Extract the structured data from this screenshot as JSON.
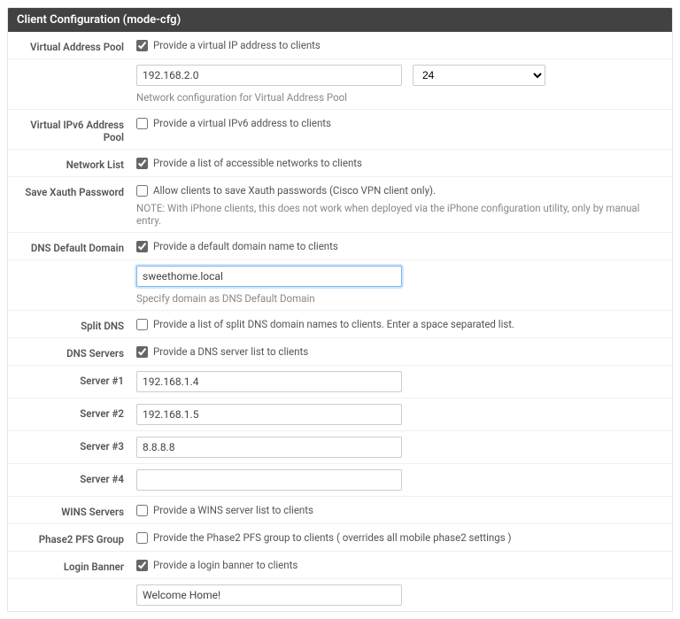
{
  "panel": {
    "title": "Client Configuration (mode-cfg)"
  },
  "virtual_address_pool": {
    "label": "Virtual Address Pool",
    "checked": true,
    "desc": "Provide a virtual IP address to clients",
    "ip_value": "192.168.2.0",
    "prefix_value": "24",
    "help": "Network configuration for Virtual Address Pool"
  },
  "virtual_ipv6_pool": {
    "label": "Virtual IPv6 Address Pool",
    "checked": false,
    "desc": "Provide a virtual IPv6 address to clients"
  },
  "network_list": {
    "label": "Network List",
    "checked": true,
    "desc": "Provide a list of accessible networks to clients"
  },
  "save_xauth": {
    "label": "Save Xauth Password",
    "checked": false,
    "desc": "Allow clients to save Xauth passwords (Cisco VPN client only).",
    "note": "NOTE: With iPhone clients, this does not work when deployed via the iPhone configuration utility, only by manual entry."
  },
  "dns_default_domain": {
    "label": "DNS Default Domain",
    "checked": true,
    "desc": "Provide a default domain name to clients",
    "value": "sweethome.local",
    "help": "Specify domain as DNS Default Domain"
  },
  "split_dns": {
    "label": "Split DNS",
    "checked": false,
    "desc": "Provide a list of split DNS domain names to clients. Enter a space separated list."
  },
  "dns_servers": {
    "label": "DNS Servers",
    "checked": true,
    "desc": "Provide a DNS server list to clients",
    "server1_label": "Server #1",
    "server1_value": "192.168.1.4",
    "server2_label": "Server #2",
    "server2_value": "192.168.1.5",
    "server3_label": "Server #3",
    "server3_value": "8.8.8.8",
    "server4_label": "Server #4",
    "server4_value": ""
  },
  "wins_servers": {
    "label": "WINS Servers",
    "checked": false,
    "desc": "Provide a WINS server list to clients"
  },
  "phase2_pfs": {
    "label": "Phase2 PFS Group",
    "checked": false,
    "desc": "Provide the Phase2 PFS group to clients ( overrides all mobile phase2 settings )"
  },
  "login_banner": {
    "label": "Login Banner",
    "checked": true,
    "desc": "Provide a login banner to clients",
    "value": "Welcome Home!"
  }
}
